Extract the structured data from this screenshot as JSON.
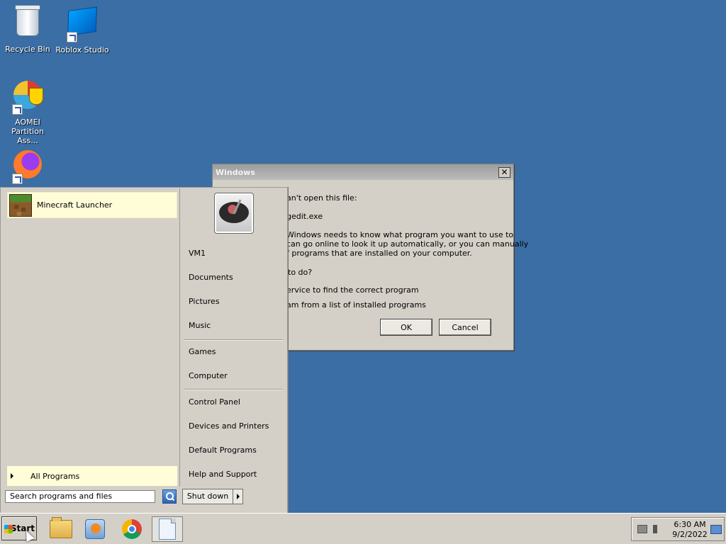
{
  "desktop": {
    "icons": [
      {
        "label": "Recycle Bin",
        "icon": "recycle-bin-icon"
      },
      {
        "label": "Roblox Studio",
        "icon": "roblox-studio-icon"
      },
      {
        "label": "AOMEI Partition Ass...",
        "icon": "aomei-icon"
      },
      {
        "label": "",
        "icon": "firefox-icon"
      }
    ]
  },
  "dialog": {
    "title": "Windows",
    "close_label": "✕",
    "lines": [
      "an't open this file:",
      "gedit.exe",
      "Windows needs to know what program you want to use to",
      "can go online to look it up automatically, or you can manually",
      "f programs that are installed on your computer.",
      "to do?",
      "ervice to find the correct program",
      "am from a list of installed programs"
    ],
    "ok_label": "OK",
    "cancel_label": "Cancel"
  },
  "start_menu": {
    "pinned": [
      {
        "label": "Minecraft Launcher",
        "icon": "minecraft-icon"
      }
    ],
    "all_programs_label": "All Programs",
    "search": {
      "placeholder": "Search programs and files"
    },
    "right_items": [
      "VM1",
      "Documents",
      "Pictures",
      "Music",
      "Games",
      "Computer",
      "Control Panel",
      "Devices and Printers",
      "Default Programs",
      "Help and Support"
    ],
    "shutdown_label": "Shut down"
  },
  "taskbar": {
    "start_label": "Start",
    "apps": [
      "file-explorer-icon",
      "media-player-icon",
      "chrome-icon",
      "document-icon"
    ],
    "clock": {
      "time": "6:30 AM",
      "date": "9/2/2022"
    }
  },
  "colors": {
    "desktop": "#3a6ea5",
    "highlight": "#fffdd8",
    "menu": "#d4d0c8"
  }
}
